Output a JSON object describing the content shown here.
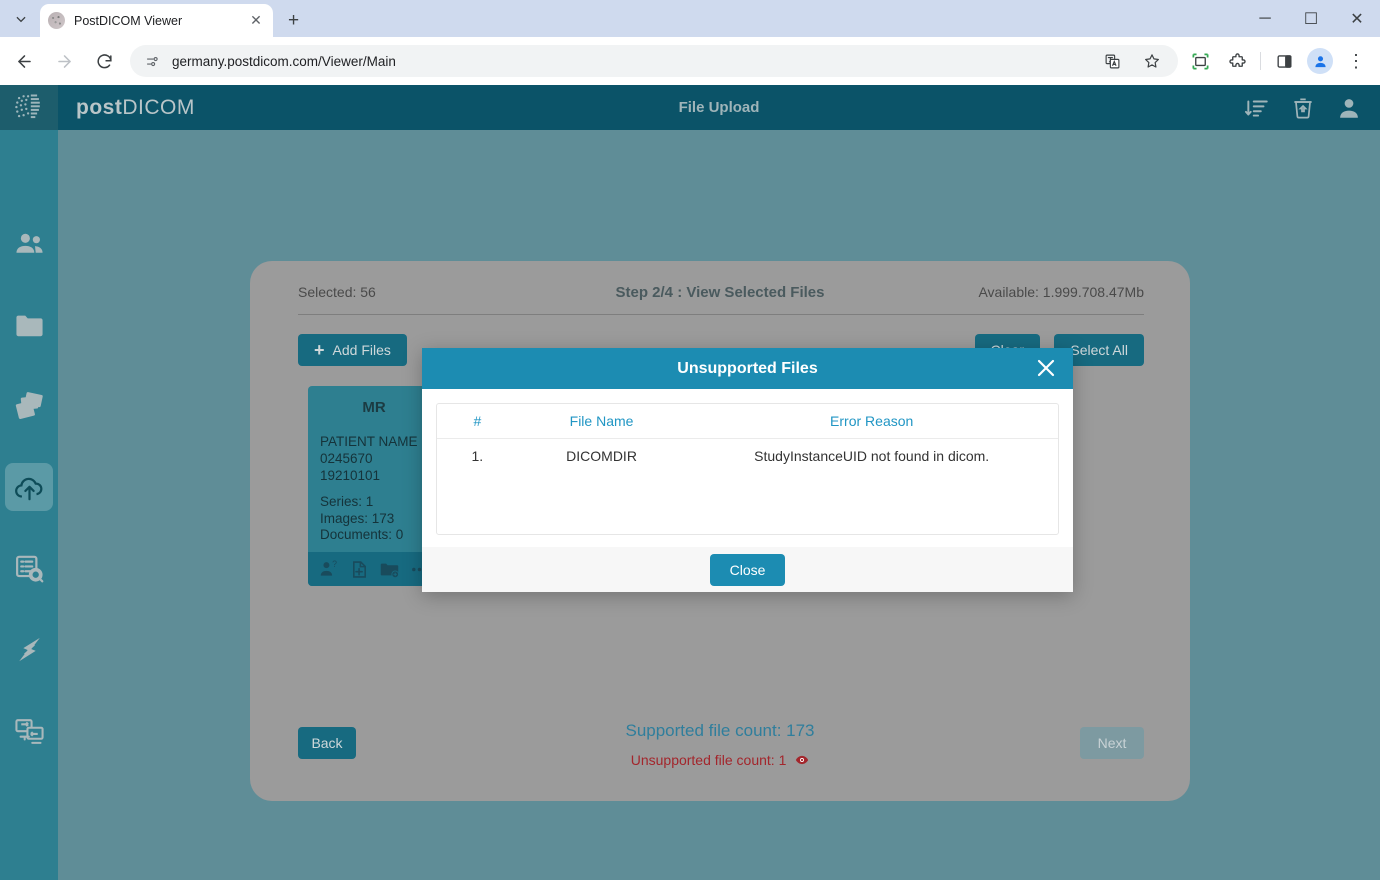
{
  "browser": {
    "tab_title": "PostDICOM Viewer",
    "tab_close": "✕",
    "new_tab": "+",
    "back": "←",
    "forward": "→",
    "reload": "⟳",
    "url": "germany.postdicom.com/Viewer/Main",
    "window_minimize": "─",
    "window_maximize": "☐",
    "window_close": "✕",
    "menu_dots": "⋮"
  },
  "app": {
    "brand_bold": "post",
    "brand_thin": "DICOM",
    "header_title": "File Upload"
  },
  "sidebar": {
    "items": [
      {
        "name": "patients",
        "label": "Patients"
      },
      {
        "name": "folders",
        "label": "Folders"
      },
      {
        "name": "studies",
        "label": "Studies"
      },
      {
        "name": "upload",
        "label": "File Upload",
        "active": true
      },
      {
        "name": "search",
        "label": "Search"
      },
      {
        "name": "sync",
        "label": "Sync"
      },
      {
        "name": "remote",
        "label": "Remote"
      }
    ]
  },
  "panel": {
    "selected_text": "Selected: 56",
    "step_text": "Step 2/4 : View Selected Files",
    "available_text": "Available: 1.999.708.47Mb",
    "add_files_label": "Add Files",
    "clear_label": "Clear",
    "select_all_label": "Select All"
  },
  "study_card": {
    "modality": "MR",
    "line1": "PATIENT NAME",
    "line2": "0245670",
    "line3": "19210101",
    "series": "Series: 1",
    "images": "Images: 173",
    "documents": "Documents: 0"
  },
  "footer": {
    "back_label": "Back",
    "next_label": "Next",
    "supported_text": "Supported file count: 173",
    "unsupported_text": "Unsupported file count: 1"
  },
  "modal": {
    "title": "Unsupported Files",
    "close_x": "✕",
    "close_label": "Close",
    "columns": [
      "#",
      "File Name",
      "Error Reason"
    ],
    "rows": [
      {
        "index": "1.",
        "file_name": "DICOMDIR",
        "error_reason": "StudyInstanceUID not found in dicom."
      }
    ]
  },
  "colors": {
    "modal_header": "#1c8cb2",
    "sidebar": "#2e7f90",
    "topbar": "#0b5368",
    "app_bg": "#5f8d97",
    "panel": "#9b9b9b",
    "error_red": "#a3262c",
    "link_blue": "#2f7e9c"
  }
}
